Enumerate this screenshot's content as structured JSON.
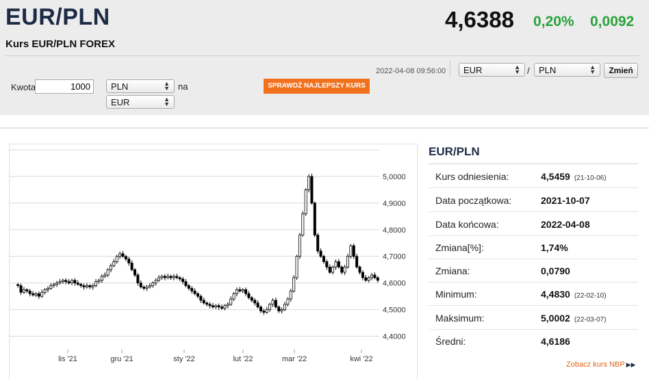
{
  "header": {
    "pair": "EUR/PLN",
    "subtitle": "Kurs EUR/PLN FOREX",
    "rate": "4,6388",
    "change_pct": "0,20%",
    "change_abs": "0,0092",
    "datetime": "2022-04-08 09:56:00"
  },
  "converter": {
    "amount_label": "Kwota",
    "amount_value": "1000",
    "from_currency": "PLN",
    "na_label": "na",
    "to_currency": "EUR",
    "check_button": "SPRAWDŹ NAJLEPSZY KURS"
  },
  "pair_selector": {
    "base": "EUR",
    "separator": "/",
    "quote": "PLN",
    "change_button": "Zmień"
  },
  "stats": {
    "title": "EUR/PLN",
    "rows": [
      {
        "label": "Kurs odniesienia:",
        "value": "4,5459",
        "date": "(21-10-06)"
      },
      {
        "label": "Data początkowa:",
        "value": "2021-10-07",
        "date": ""
      },
      {
        "label": "Data końcowa:",
        "value": "2022-04-08",
        "date": ""
      },
      {
        "label": "Zmiana[%]:",
        "value": "1,74%",
        "date": ""
      },
      {
        "label": "Zmiana:",
        "value": "0,0790",
        "date": ""
      },
      {
        "label": "Minimum:",
        "value": "4,4830",
        "date": "(22-02-10)"
      },
      {
        "label": "Maksimum:",
        "value": "5,0002",
        "date": "(22-03-07)"
      },
      {
        "label": "Średni:",
        "value": "4,6186",
        "date": ""
      }
    ],
    "nbp_link": "Zobacz kurs NBP"
  },
  "chart_data": {
    "type": "candlestick",
    "title": "",
    "xlabel": "",
    "ylabel": "",
    "x_tick_labels": [
      "lis '21",
      "gru '21",
      "sty '22",
      "lut '22",
      "mar '22",
      "kwi '22"
    ],
    "y_tick_labels": [
      "4,4000",
      "4,5000",
      "4,6000",
      "4,7000",
      "4,8000",
      "4,9000",
      "5,0000"
    ],
    "y_ticks": [
      4.4,
      4.5,
      4.6,
      4.7,
      4.8,
      4.9,
      5.0
    ],
    "ylim": [
      4.35,
      5.1
    ],
    "grid": true,
    "up_color": "#ffffff",
    "down_color": "#000000",
    "closes": [
      4.59,
      4.565,
      4.575,
      4.57,
      4.56,
      4.555,
      4.56,
      4.55,
      4.565,
      4.575,
      4.58,
      4.59,
      4.595,
      4.6,
      4.605,
      4.61,
      4.605,
      4.6,
      4.61,
      4.6,
      4.595,
      4.59,
      4.585,
      4.59,
      4.585,
      4.59,
      4.605,
      4.61,
      4.625,
      4.63,
      4.65,
      4.665,
      4.68,
      4.7,
      4.71,
      4.7,
      4.69,
      4.675,
      4.65,
      4.63,
      4.6,
      4.585,
      4.58,
      4.585,
      4.59,
      4.6,
      4.61,
      4.62,
      4.625,
      4.62,
      4.625,
      4.62,
      4.625,
      4.62,
      4.615,
      4.605,
      4.59,
      4.58,
      4.57,
      4.56,
      4.55,
      4.535,
      4.525,
      4.52,
      4.515,
      4.51,
      4.515,
      4.51,
      4.505,
      4.515,
      4.52,
      4.54,
      4.56,
      4.575,
      4.57,
      4.575,
      4.56,
      4.545,
      4.535,
      4.525,
      4.51,
      4.495,
      4.49,
      4.5,
      4.52,
      4.535,
      4.51,
      4.495,
      4.5,
      4.52,
      4.54,
      4.57,
      4.62,
      4.7,
      4.78,
      4.86,
      4.95,
      5.0,
      4.9,
      4.78,
      4.72,
      4.7,
      4.68,
      4.66,
      4.64,
      4.66,
      4.68,
      4.66,
      4.64,
      4.66,
      4.7,
      4.74,
      4.7,
      4.66,
      4.64,
      4.62,
      4.61,
      4.62,
      4.63,
      4.62,
      4.61
    ]
  }
}
